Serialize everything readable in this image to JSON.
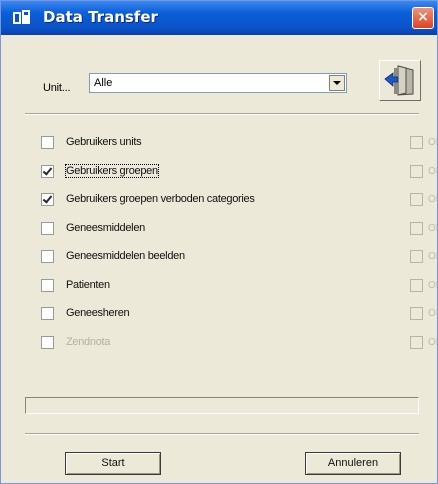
{
  "window": {
    "title": "Data Transfer",
    "close_glyph": "×"
  },
  "unit": {
    "label": "Unit...",
    "value": "Alle"
  },
  "exit_button": {
    "icon": "exit-door-icon"
  },
  "tasks": [
    {
      "label": "Gebruikers units",
      "checked": false,
      "enabled": true,
      "ok_label": "OK",
      "ok_checked": false
    },
    {
      "label": "Gebruikers groepen",
      "checked": true,
      "enabled": true,
      "focused": true,
      "ok_label": "OK",
      "ok_checked": false
    },
    {
      "label": "Gebruikers groepen verboden categories",
      "checked": true,
      "enabled": true,
      "ok_label": "OK",
      "ok_checked": false
    },
    {
      "label": "Geneesmiddelen",
      "checked": false,
      "enabled": true,
      "ok_label": "OK",
      "ok_checked": false
    },
    {
      "label": "Geneesmiddelen beelden",
      "checked": false,
      "enabled": true,
      "ok_label": "OK",
      "ok_checked": false
    },
    {
      "label": "Patienten",
      "checked": false,
      "enabled": true,
      "ok_label": "OK",
      "ok_checked": false
    },
    {
      "label": "Geneesheren",
      "checked": false,
      "enabled": true,
      "ok_label": "OK",
      "ok_checked": false
    },
    {
      "label": "Zendnota",
      "checked": false,
      "enabled": false,
      "ok_label": "OK",
      "ok_checked": false
    }
  ],
  "progress": {
    "value": 0
  },
  "buttons": {
    "start": "Start",
    "cancel": "Annuleren"
  },
  "colors": {
    "titlebar": "#0a52c8",
    "window_bg": "#ece9d8",
    "close": "#d8451f"
  }
}
